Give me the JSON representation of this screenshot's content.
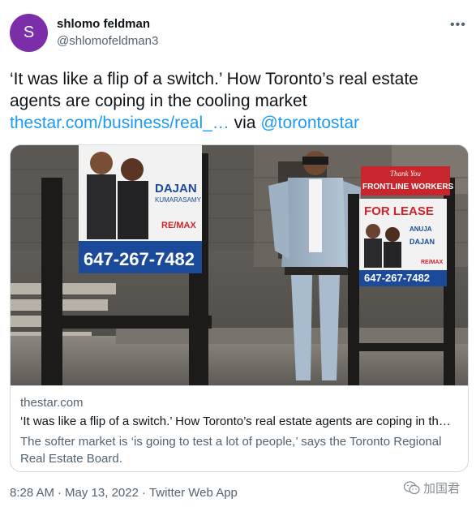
{
  "tweet": {
    "avatar_letter": "S",
    "avatar_color": "#7b2ea8",
    "author_name": "shlomo feldman",
    "author_handle": "@shlomofeldman3",
    "more_icon": "more-icon",
    "text_line1": "‘It was like a flip of a switch.’ How Toronto’s real estate",
    "text_line2": "agents are coping in the cooling market",
    "link_url": "thestar.com/business/real_…",
    "via": " via ",
    "mention": "@torontostar",
    "link_color": "#1d9bf0"
  },
  "card": {
    "image_icon": "photo-realtor-signs",
    "sign_left_name": "DAJAN",
    "sign_left_sub": "KUMARASAMY",
    "sign_left_brand": "RE/MAX",
    "sign_left_phone": "647-267-7482",
    "sign_right_banner": "Thank You",
    "sign_right_banner2": "FRONTLINE WORKERS",
    "sign_right_title": "FOR LEASE",
    "sign_right_name1": "ANUJA",
    "sign_right_name2": "DAJAN",
    "sign_right_brand": "RE/MAX",
    "sign_right_phone": "647-267-7482",
    "domain": "thestar.com",
    "title": "‘It was like a flip of a switch.’ How Toronto’s real estate agents are coping in th…",
    "description": "The softer market is ‘is going to test a lot of people,’ says the Toronto Regional Real Estate Board."
  },
  "footer": {
    "time": "8:28 AM",
    "dot": "·",
    "date": "May 13, 2022",
    "source": "Twitter Web App"
  },
  "watermark": {
    "icon": "wechat-icon",
    "text": "加国君"
  }
}
